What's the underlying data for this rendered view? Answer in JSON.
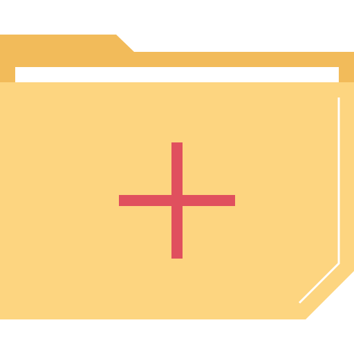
{
  "icon": {
    "name": "new-folder-icon",
    "glyph": "folder-plus"
  },
  "colors": {
    "background": "#ffffff",
    "folder_back": "#F2BB5A",
    "folder_front": "#FDD580",
    "paper": "#ffffff",
    "highlight": "#ffffff",
    "plus": "#E0505E"
  }
}
